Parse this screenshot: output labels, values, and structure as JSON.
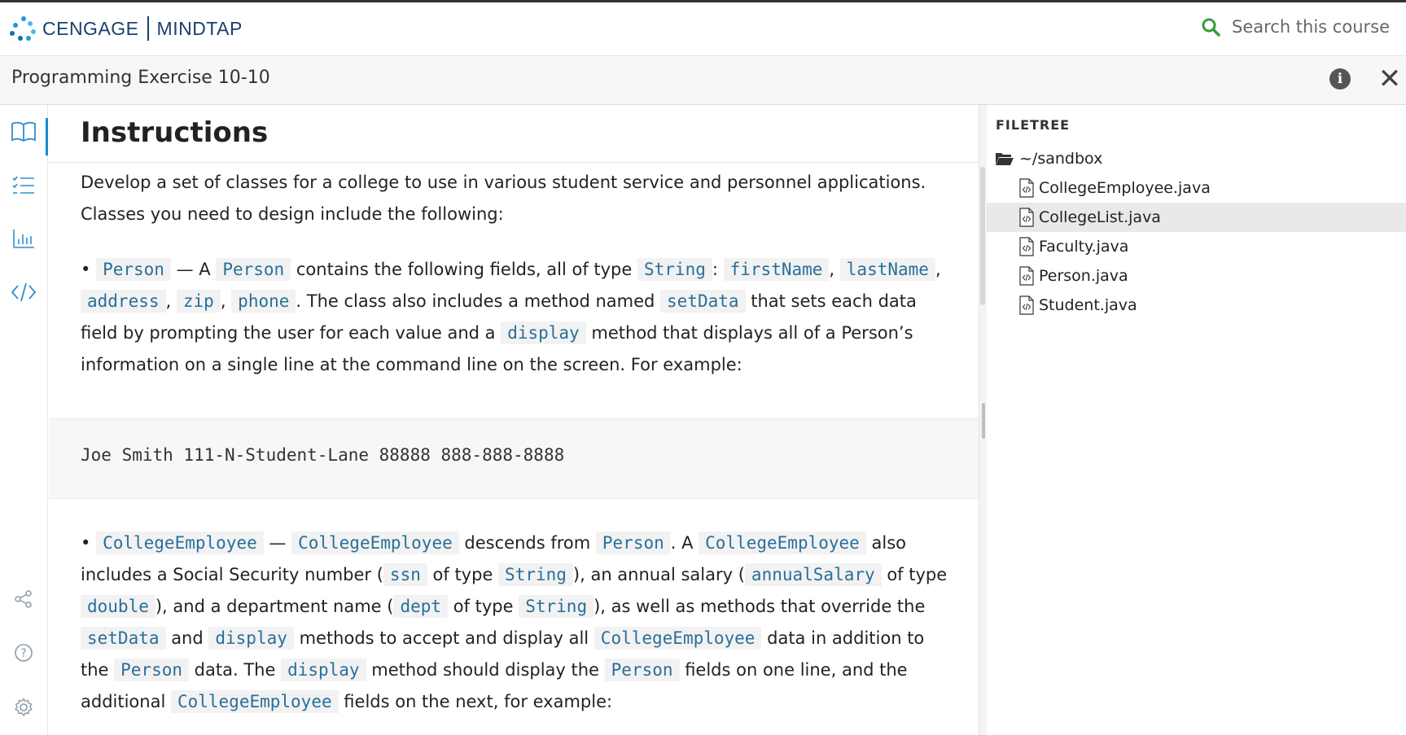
{
  "header": {
    "brand_left": "CENGAGE",
    "brand_right": "MINDTAP",
    "search_placeholder": "Search this course",
    "brand_color": "#1b3f6b",
    "search_icon_color": "#3a9b3a"
  },
  "titlebar": {
    "title": "Programming Exercise 10-10",
    "info_label": "i",
    "close_label": "✕"
  },
  "rail": {
    "items": [
      "book-icon",
      "checklist-icon",
      "bar-chart-icon",
      "code-icon",
      "share-icon",
      "help-icon",
      "settings-icon"
    ]
  },
  "instructions": {
    "title": "Instructions",
    "intro": "Develop a set of classes for a college to use in various student service and personnel applications. Classes you need to design include the following:",
    "person": {
      "bullet": "•",
      "name": "Person",
      "t1": " — A ",
      "t2": " contains the following fields, all of type ",
      "type_string": "String",
      "t3": ": ",
      "f1": "firstName",
      "f2": "lastName",
      "f3": "address",
      "f4": "zip",
      "f5": "phone",
      "comma": ", ",
      "t4": ". The class also includes a method named ",
      "setData": "setData",
      "t5": " that sets each data field by prompting the user for each value and a ",
      "display": "display",
      "t6": " method that displays all of a Person’s information on a single line at the command line on the screen. For example:"
    },
    "example_output": "Joe Smith 111-N-Student-Lane 88888 888-888-8888",
    "college_employee": {
      "bullet": "•",
      "name": "CollegeEmployee",
      "dash": " — ",
      "t1": " descends from ",
      "person": "Person",
      "t2": ". A ",
      "t3": " also includes a Social Security number (",
      "ssn": "ssn",
      "t4": " of type ",
      "type_string": "String",
      "t5": "), an annual salary (",
      "annualSalary": "annualSalary",
      "type_double": "double",
      "t6": "), and a department name (",
      "dept": "dept",
      "t7": "), as well as methods that override the ",
      "setData": "setData",
      "and": " and ",
      "display": "display",
      "t8": " methods to accept and display all ",
      "t9": " data in addition to the ",
      "t10": " data. The ",
      "t11": " method should display the ",
      "t12": " fields on one line, and the additional ",
      "t13": " fields on the next, for example:"
    }
  },
  "filetree": {
    "heading": "FILETREE",
    "root": "~/sandbox",
    "files": [
      {
        "name": "CollegeEmployee.java",
        "selected": false
      },
      {
        "name": "CollegeList.java",
        "selected": true
      },
      {
        "name": "Faculty.java",
        "selected": false
      },
      {
        "name": "Person.java",
        "selected": false
      },
      {
        "name": "Student.java",
        "selected": false
      }
    ]
  }
}
